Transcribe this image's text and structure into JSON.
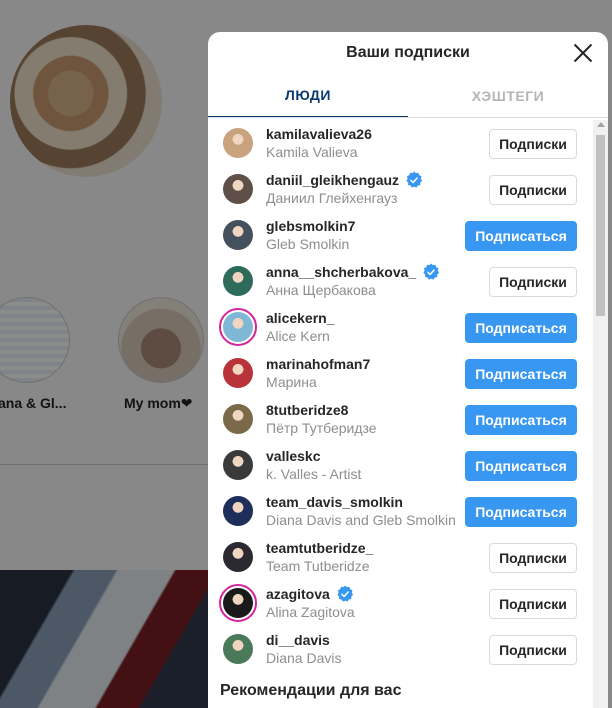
{
  "background": {
    "highlights": [
      {
        "label": "ana & Gl..."
      },
      {
        "label": "My mom❤"
      }
    ]
  },
  "modal": {
    "title": "Ваши подписки",
    "tabs": [
      {
        "label": "ЛЮДИ",
        "active": true
      },
      {
        "label": "ХЭШТЕГИ",
        "active": false
      }
    ],
    "users": [
      {
        "username": "kamilavalieva26",
        "fullname": "Kamila Valieva",
        "verified": false,
        "button": "Подписки",
        "state": "following",
        "avatar_color": "#c9a27e",
        "story": false
      },
      {
        "username": "daniil_gleikhengauz",
        "fullname": "Даниил Глейхенгауз",
        "verified": true,
        "button": "Подписки",
        "state": "following",
        "avatar_color": "#5e5048",
        "story": false
      },
      {
        "username": "glebsmolkin7",
        "fullname": "Gleb Smolkin",
        "verified": false,
        "button": "Подписаться",
        "state": "follow",
        "avatar_color": "#44505c",
        "story": false
      },
      {
        "username": "anna__shcherbakova_",
        "fullname": "Анна Щербакова",
        "verified": true,
        "button": "Подписки",
        "state": "following",
        "avatar_color": "#2e6b5a",
        "story": false
      },
      {
        "username": "alicekern_",
        "fullname": "Alice Kern",
        "verified": false,
        "button": "Подписаться",
        "state": "follow",
        "avatar_color": "#7fb8d6",
        "story": true
      },
      {
        "username": "marinahofman7",
        "fullname": "Марина",
        "verified": false,
        "button": "Подписаться",
        "state": "follow",
        "avatar_color": "#b8343a",
        "story": false
      },
      {
        "username": "8tutberidze8",
        "fullname": "Пётр Тутберидзе",
        "verified": false,
        "button": "Подписаться",
        "state": "follow",
        "avatar_color": "#7a6a4a",
        "story": false
      },
      {
        "username": "valleskc",
        "fullname": "k. Valles - Artist",
        "verified": false,
        "button": "Подписаться",
        "state": "follow",
        "avatar_color": "#3a3a3a",
        "story": false
      },
      {
        "username": "team_davis_smolkin",
        "fullname": "Diana Davis and Gleb Smolkin",
        "verified": false,
        "button": "Подписаться",
        "state": "follow",
        "avatar_color": "#1e2e5a",
        "story": false
      },
      {
        "username": "teamtutberidze_",
        "fullname": "Team Tutberidze",
        "verified": false,
        "button": "Подписки",
        "state": "following",
        "avatar_color": "#2a2a30",
        "story": false
      },
      {
        "username": "azagitova",
        "fullname": "Alina Zagitova",
        "verified": true,
        "button": "Подписки",
        "state": "following",
        "avatar_color": "#1a1a1a",
        "story": true
      },
      {
        "username": "di__davis",
        "fullname": "Diana Davis",
        "verified": false,
        "button": "Подписки",
        "state": "following",
        "avatar_color": "#4a7a5a",
        "story": false
      }
    ],
    "section_title": "Рекомендации для вас"
  },
  "colors": {
    "follow_button": "#3897f0",
    "active_tab": "#0b3a6e",
    "verified_badge": "#3897f0"
  }
}
